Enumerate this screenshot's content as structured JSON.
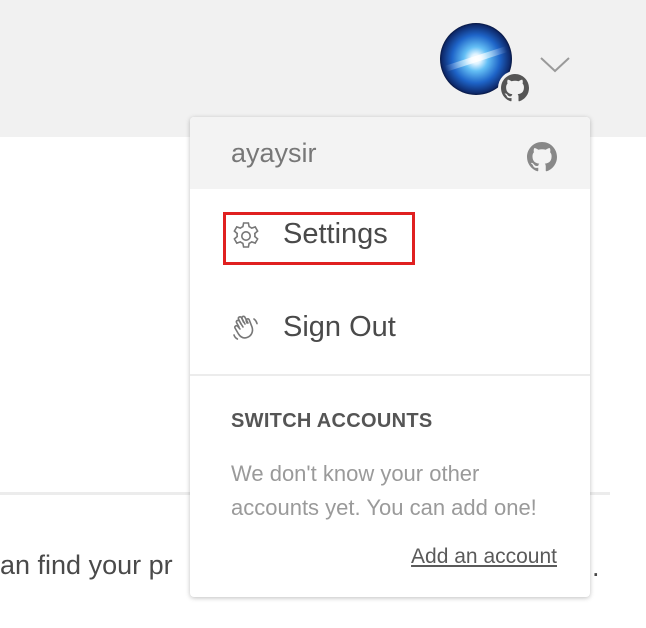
{
  "background": {
    "partial_text": "an find your pr",
    "trailing_text": "."
  },
  "header": {
    "avatar_icon": "user-avatar",
    "avatar_badge_icon": "github-icon",
    "menu_toggle_icon": "chevron-down-icon"
  },
  "dropdown": {
    "username": "ayaysir",
    "username_icon": "github-icon",
    "items": [
      {
        "label": "Settings",
        "icon": "gear-icon",
        "highlighted": true
      },
      {
        "label": "Sign Out",
        "icon": "waving-hand-icon",
        "highlighted": false
      }
    ],
    "switch_accounts": {
      "heading": "SWITCH ACCOUNTS",
      "description": "We don't know your other accounts yet. You can add one!",
      "add_link": "Add an account"
    }
  },
  "colors": {
    "header_bg": "#f1f1f1",
    "highlight_border": "#e02020",
    "text_primary": "#4a4a4a",
    "text_muted": "#9a9a9a"
  }
}
